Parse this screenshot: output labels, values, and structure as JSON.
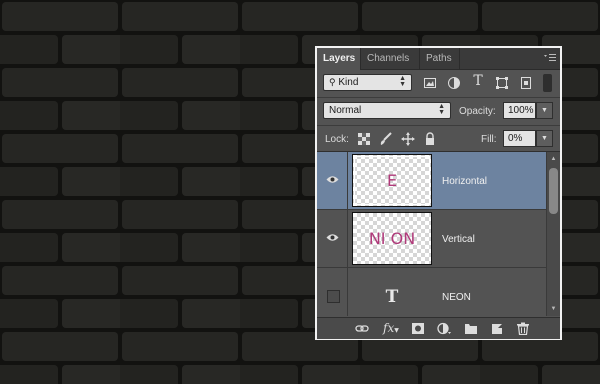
{
  "panel": {
    "tabs": [
      "Layers",
      "Channels",
      "Paths"
    ],
    "filter": {
      "selected": "Kind"
    },
    "blend_mode": {
      "selected": "Normal"
    },
    "opacity": {
      "label": "Opacity:",
      "value": "100%"
    },
    "lock": {
      "label": "Lock:"
    },
    "fill": {
      "label": "Fill:",
      "value": "0%"
    },
    "layers": [
      {
        "name": "Horizontal",
        "thumb_text": "E",
        "selected": true,
        "visible": true
      },
      {
        "name": "Vertical",
        "thumb_text": "NI ON",
        "selected": false,
        "visible": true
      },
      {
        "name": "NEON",
        "thumb_text": "T",
        "selected": false,
        "visible": false
      }
    ],
    "filter_icons": [
      "image-filter-icon",
      "adjustment-filter-icon",
      "type-filter-icon",
      "shape-filter-icon",
      "smart-object-filter-icon"
    ],
    "lock_icons": [
      "lock-transparent-icon",
      "lock-image-icon",
      "lock-position-icon",
      "lock-all-icon"
    ],
    "footer_icons": [
      "link-layers-icon",
      "fx-icon",
      "layer-mask-icon",
      "adjustment-layer-icon",
      "new-group-icon",
      "new-layer-icon",
      "delete-layer-icon"
    ]
  },
  "colors": {
    "panel_bg": "#535353",
    "selected_layer": "#6d83a0",
    "thumb_text": "#b03a7a",
    "background": "#1a1a18"
  }
}
